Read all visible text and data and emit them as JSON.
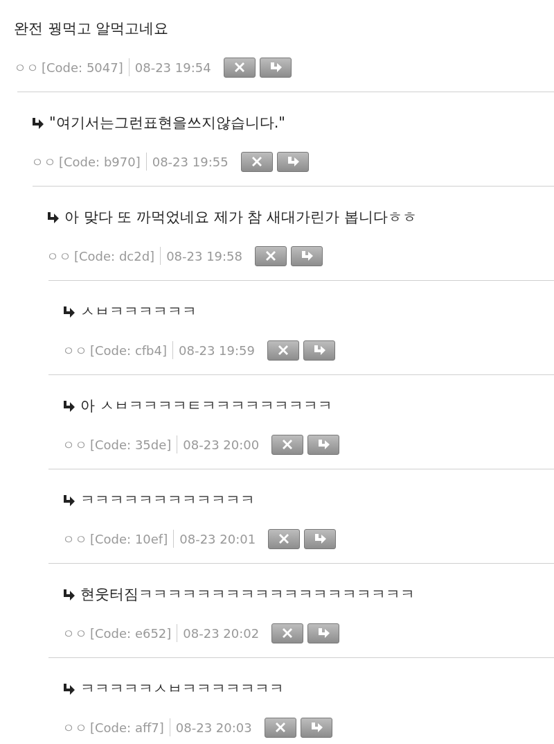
{
  "comment": {
    "text": "완전 꿩먹고 알먹고네요",
    "author": "ㅇㅇ",
    "code": "[Code: 5047]",
    "time": "08-23 19:54",
    "children": [
      {
        "text": "\"여기서는그런표현을쓰지않습니다.\"",
        "author": "ㅇㅇ",
        "code": "[Code: b970]",
        "time": "08-23 19:55",
        "children": [
          {
            "text": "아 맞다 또 까먹었네요 제가 참 새대가린가 봅니다ㅎㅎ",
            "author": "ㅇㅇ",
            "code": "[Code: dc2d]",
            "time": "08-23 19:58",
            "children": [
              {
                "text": "ㅅㅂㅋㅋㅋㅋㅋㅋ",
                "author": "ㅇㅇ",
                "code": "[Code: cfb4]",
                "time": "08-23 19:59"
              },
              {
                "text": "아 ㅅㅂㅋㅋㅋㅋㅌㅋㅋㅋㅋㅋㅋㅋㅋㅋ",
                "author": "ㅇㅇ",
                "code": "[Code: 35de]",
                "time": "08-23 20:00"
              },
              {
                "text": "ㅋㅋㅋㅋㅋㅋㅋㅋㅋㅋㅋㅋ",
                "author": "ㅇㅇ",
                "code": "[Code: 10ef]",
                "time": "08-23 20:01"
              },
              {
                "text": "현웃터짐ㅋㅋㅋㅋㅋㅋㅋㅋㅋㅋㅋㅋㅋㅋㅋㅋㅋㅋㅋ",
                "author": "ㅇㅇ",
                "code": "[Code: e652]",
                "time": "08-23 20:02"
              },
              {
                "text": "ㅋㅋㅋㅋㅋㅅㅂㅋㅋㅋㅋㅋㅋㅋ",
                "author": "ㅇㅇ",
                "code": "[Code: aff7]",
                "time": "08-23 20:03"
              }
            ]
          }
        ]
      }
    ]
  }
}
